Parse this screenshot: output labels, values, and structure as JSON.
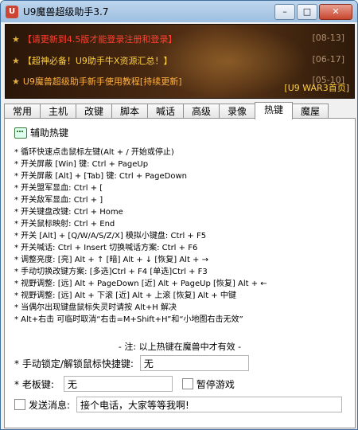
{
  "window": {
    "title": "U9魔兽超级助手3.7",
    "buttons": {
      "minimize": "–",
      "maximize": "□",
      "close": "✕"
    }
  },
  "banner": {
    "news": [
      {
        "text": "【请更新到4.5版才能登录注册和登录】",
        "date": "[08-13]"
      },
      {
        "text": "【超神必备！U9助手牛X资源汇总！】",
        "date": "[06-17]"
      },
      {
        "text": "U9魔兽超级助手新手使用教程[持续更新]",
        "date": "[05-10]"
      }
    ],
    "home_link": "[U9 WAR3首页]"
  },
  "tabs": [
    "常用",
    "主机",
    "改键",
    "脚本",
    "喊话",
    "高级",
    "录像",
    "热键",
    "魔屋"
  ],
  "active_tab": "热键",
  "hotkeys": {
    "section_title": "辅助热键",
    "lines": [
      "* 循环快速点击鼠标左键(Alt + / 开始或停止)",
      "* 开关屏蔽 [Win] 键: Ctrl + PageUp",
      "* 开关屏蔽 [Alt] + [Tab] 键: Ctrl + PageDown",
      "* 开关盟军显血: Ctrl + [",
      "* 开关敌军显血: Ctrl + ]",
      "* 开关键盘改键: Ctrl + Home",
      "* 开关鼠标映射: Ctrl + End",
      "* 开关 [Alt] + [Q/W/A/S/Z/X] 模拟小键盘: Ctrl + F5",
      "* 开关喊话: Ctrl + Insert      切换喊话方案: Ctrl + F6",
      "* 调整亮度: [亮] Alt + ↑  [暗] Alt + ↓  [恢复] Alt + →",
      "* 手动切换改键方案: [多选]Ctrl + F4  [单选]Ctrl + F3",
      "* 视野调整: [远] Alt + PageDown [近] Alt + PageUp [恢复] Alt + ←",
      "* 视野调整: [远] Alt + 下滚 [近] Alt + 上滚 [恢复] Alt + 中键",
      "* 当偶尔出现键盘鼠标失灵时请按 Alt+H 解决",
      "* Alt+右击 可临时取消“右击=M+Shift+H”和“小地图右击无效”"
    ],
    "note": "- 注: 以上热键在魔兽中才有效 -"
  },
  "controls": {
    "mouse_lock_label": "* 手动锁定/解锁鼠标快捷键:",
    "mouse_lock_value": "无",
    "boss_key_label": "* 老板键:",
    "boss_key_value": "无",
    "pause_game_label": "暂停游戏",
    "send_msg_label": "发送消息:",
    "send_msg_value": "接个电话，大家等等我啊!"
  }
}
